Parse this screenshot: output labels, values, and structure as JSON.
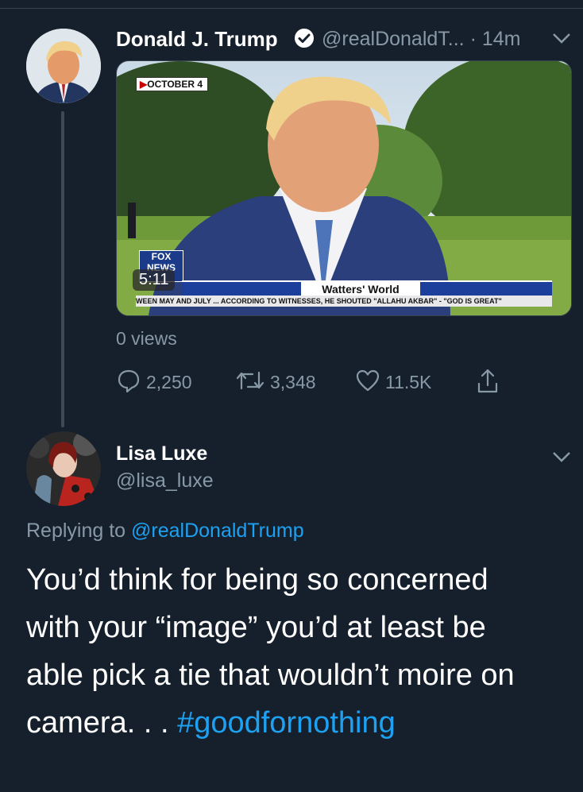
{
  "tweet": {
    "author_name": "Donald J. Trump",
    "author_handle": "@realDonaldT...",
    "separator": "·",
    "time": "14m",
    "media": {
      "date_label": "OCTOBER 4",
      "channel_logo": "FOX NEWS",
      "clock": "5:11",
      "show_name": "Watters' World",
      "ticker": "WEEN MAY AND JULY ... ACCORDING TO WITNESSES, HE SHOUTED \"ALLAHU AKBAR\" - \"GOD IS GREAT\""
    },
    "views": "0 views",
    "replies": "2,250",
    "retweets": "3,348",
    "likes": "11.5K"
  },
  "reply": {
    "author_name": "Lisa Luxe",
    "author_handle": "@lisa_luxe",
    "replying_prefix": "Replying to",
    "replying_to": "@realDonaldTrump",
    "text_line1": "You’d think for being so concerned",
    "text_line2": "with  your “image” you’d at least be",
    "text_line3": "able pick a tie that wouldn’t moire on",
    "text_line4": "camera. . . ",
    "hashtag": "#goodfornothing"
  },
  "colors": {
    "background": "#16202c",
    "secondary_text": "#8899a6",
    "link": "#1da1f2",
    "verified_badge": "#ffffff"
  },
  "icons": [
    "verified-badge-icon",
    "chevron-down-icon",
    "reply-icon",
    "retweet-icon",
    "like-icon",
    "share-icon"
  ]
}
